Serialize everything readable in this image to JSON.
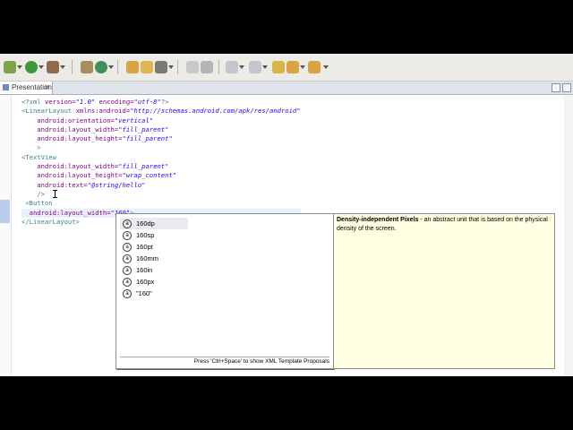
{
  "tab": {
    "label": "Presentation.xml"
  },
  "code_lines": [
    [
      {
        "t": "<?",
        "c": "kw"
      },
      {
        "t": "xml ",
        "c": "kw"
      },
      {
        "t": "version=",
        "c": "at"
      },
      {
        "t": "\"1.0\"",
        "c": "val"
      },
      {
        "t": " encoding=",
        "c": "at"
      },
      {
        "t": "\"utf-8\"",
        "c": "val"
      },
      {
        "t": "?>",
        "c": "kw"
      }
    ],
    [
      {
        "t": "<LinearLayout ",
        "c": "kw"
      },
      {
        "t": "xmlns:android=",
        "c": "at"
      },
      {
        "t": "\"http://schemas.android.com/apk/res/android\"",
        "c": "val"
      }
    ],
    [
      {
        "t": "    android:orientation=",
        "c": "at"
      },
      {
        "t": "\"vertical\"",
        "c": "val"
      }
    ],
    [
      {
        "t": "    android:layout_width=",
        "c": "at"
      },
      {
        "t": "\"fill_parent\"",
        "c": "val"
      }
    ],
    [
      {
        "t": "    android:layout_height=",
        "c": "at"
      },
      {
        "t": "\"fill_parent\"",
        "c": "val"
      }
    ],
    [
      {
        "t": "    >",
        "c": "kw"
      }
    ],
    [
      {
        "t": "<TextView",
        "c": "kw"
      }
    ],
    [
      {
        "t": "    android:layout_width=",
        "c": "at"
      },
      {
        "t": "\"fill_parent\"",
        "c": "val"
      }
    ],
    [
      {
        "t": "    android:layout_height=",
        "c": "at"
      },
      {
        "t": "\"wrap_content\"",
        "c": "val"
      }
    ],
    [
      {
        "t": "    android:text=",
        "c": "at"
      },
      {
        "t": "\"@string/hello\"",
        "c": "val"
      }
    ],
    [
      {
        "t": "    />",
        "c": "kw"
      }
    ],
    [
      {
        "t": " <Button",
        "c": "kw"
      }
    ],
    [
      {
        "t": "  android:layout_width=",
        "c": "at"
      },
      {
        "t": "\"160\"",
        "c": "val"
      },
      {
        "t": ">",
        "c": "kw"
      }
    ],
    [
      {
        "t": "</LinearLayout>",
        "c": "kw"
      }
    ]
  ],
  "proposals": {
    "items": [
      "160dp",
      "160sp",
      "160pt",
      "160mm",
      "160in",
      "160px",
      "\"160\""
    ],
    "selected_index": 0,
    "status": "Press 'Ctrl+Space' to show XML Template Proposals"
  },
  "doc": {
    "term": "Density-independent Pixels",
    "text": " - an abstract unit that is based on the physical density of the screen."
  },
  "colors": {
    "tag": "#3f7f7f",
    "attribute": "#7f007f",
    "value": "#2a00ff",
    "doc_background": "#ffffe1"
  }
}
